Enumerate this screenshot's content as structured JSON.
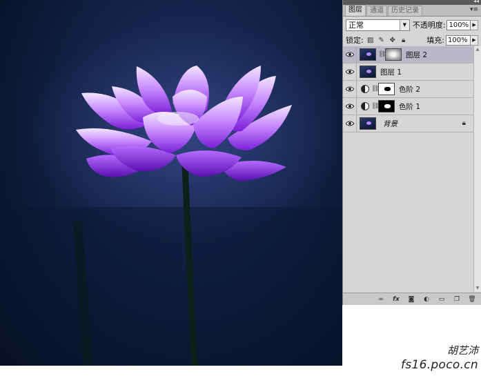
{
  "panel": {
    "tabs": [
      {
        "label": "图层",
        "active": true
      },
      {
        "label": "通道",
        "active": false
      },
      {
        "label": "历史记录",
        "active": false
      }
    ],
    "blend_mode": "正常",
    "opacity_label": "不透明度:",
    "opacity_value": "100%",
    "lock_label": "锁定:",
    "fill_label": "填充:",
    "fill_value": "100%",
    "layers": [
      {
        "name": "图层 2",
        "selected": true,
        "kind": "pixel-with-mask"
      },
      {
        "name": "图层 1",
        "selected": false,
        "kind": "pixel"
      },
      {
        "name": "色阶 2",
        "selected": false,
        "kind": "adjustment-white-mask"
      },
      {
        "name": "色阶 1",
        "selected": false,
        "kind": "adjustment-black-mask"
      },
      {
        "name": "背景",
        "selected": false,
        "kind": "background-locked"
      }
    ]
  },
  "watermark": {
    "author": "胡艺沛",
    "site": "fs16.poco.cn"
  },
  "colors": {
    "panel_bg": "#d6d6d6",
    "selected_layer": "#b8b8c8",
    "photo_bg": "#0b1530",
    "petal": "#a24cf0"
  }
}
